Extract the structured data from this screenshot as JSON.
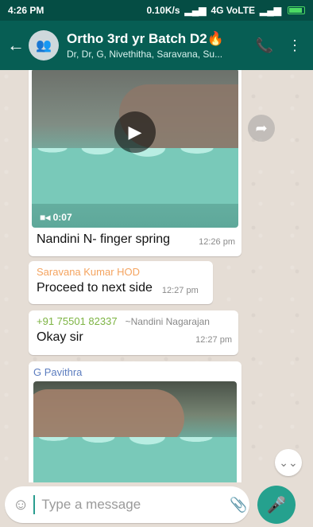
{
  "status_bar": {
    "time": "4:26 PM",
    "network_speed": "0.10K/s",
    "network_type": "4G VoLTE"
  },
  "header": {
    "title": "Ortho 3rd yr Batch D2",
    "title_emoji": "🔥",
    "subtitle": "Dr, Dr, G, Nivethitha, Saravana, Su..."
  },
  "messages": [
    {
      "type": "video",
      "duration": "0:07",
      "caption": "Nandini N- finger spring",
      "time": "12:26 pm"
    },
    {
      "type": "text",
      "sender": "Saravana Kumar HOD",
      "sender_color": "#f4a460",
      "text": "Proceed to next side",
      "time": "12:27 pm"
    },
    {
      "type": "text",
      "sender": "+91 75501 82337",
      "sender_alt": "~Nandini Nagarajan",
      "sender_color": "#7cb342",
      "text": "Okay sir",
      "time": "12:27 pm"
    },
    {
      "type": "video",
      "sender": "G Pavithra",
      "sender_color": "#5c7dbf"
    }
  ],
  "input": {
    "placeholder": "Type a message"
  },
  "colors": {
    "header": "#075e54",
    "status_bar": "#054d44",
    "mic_button": "#25a18e"
  }
}
